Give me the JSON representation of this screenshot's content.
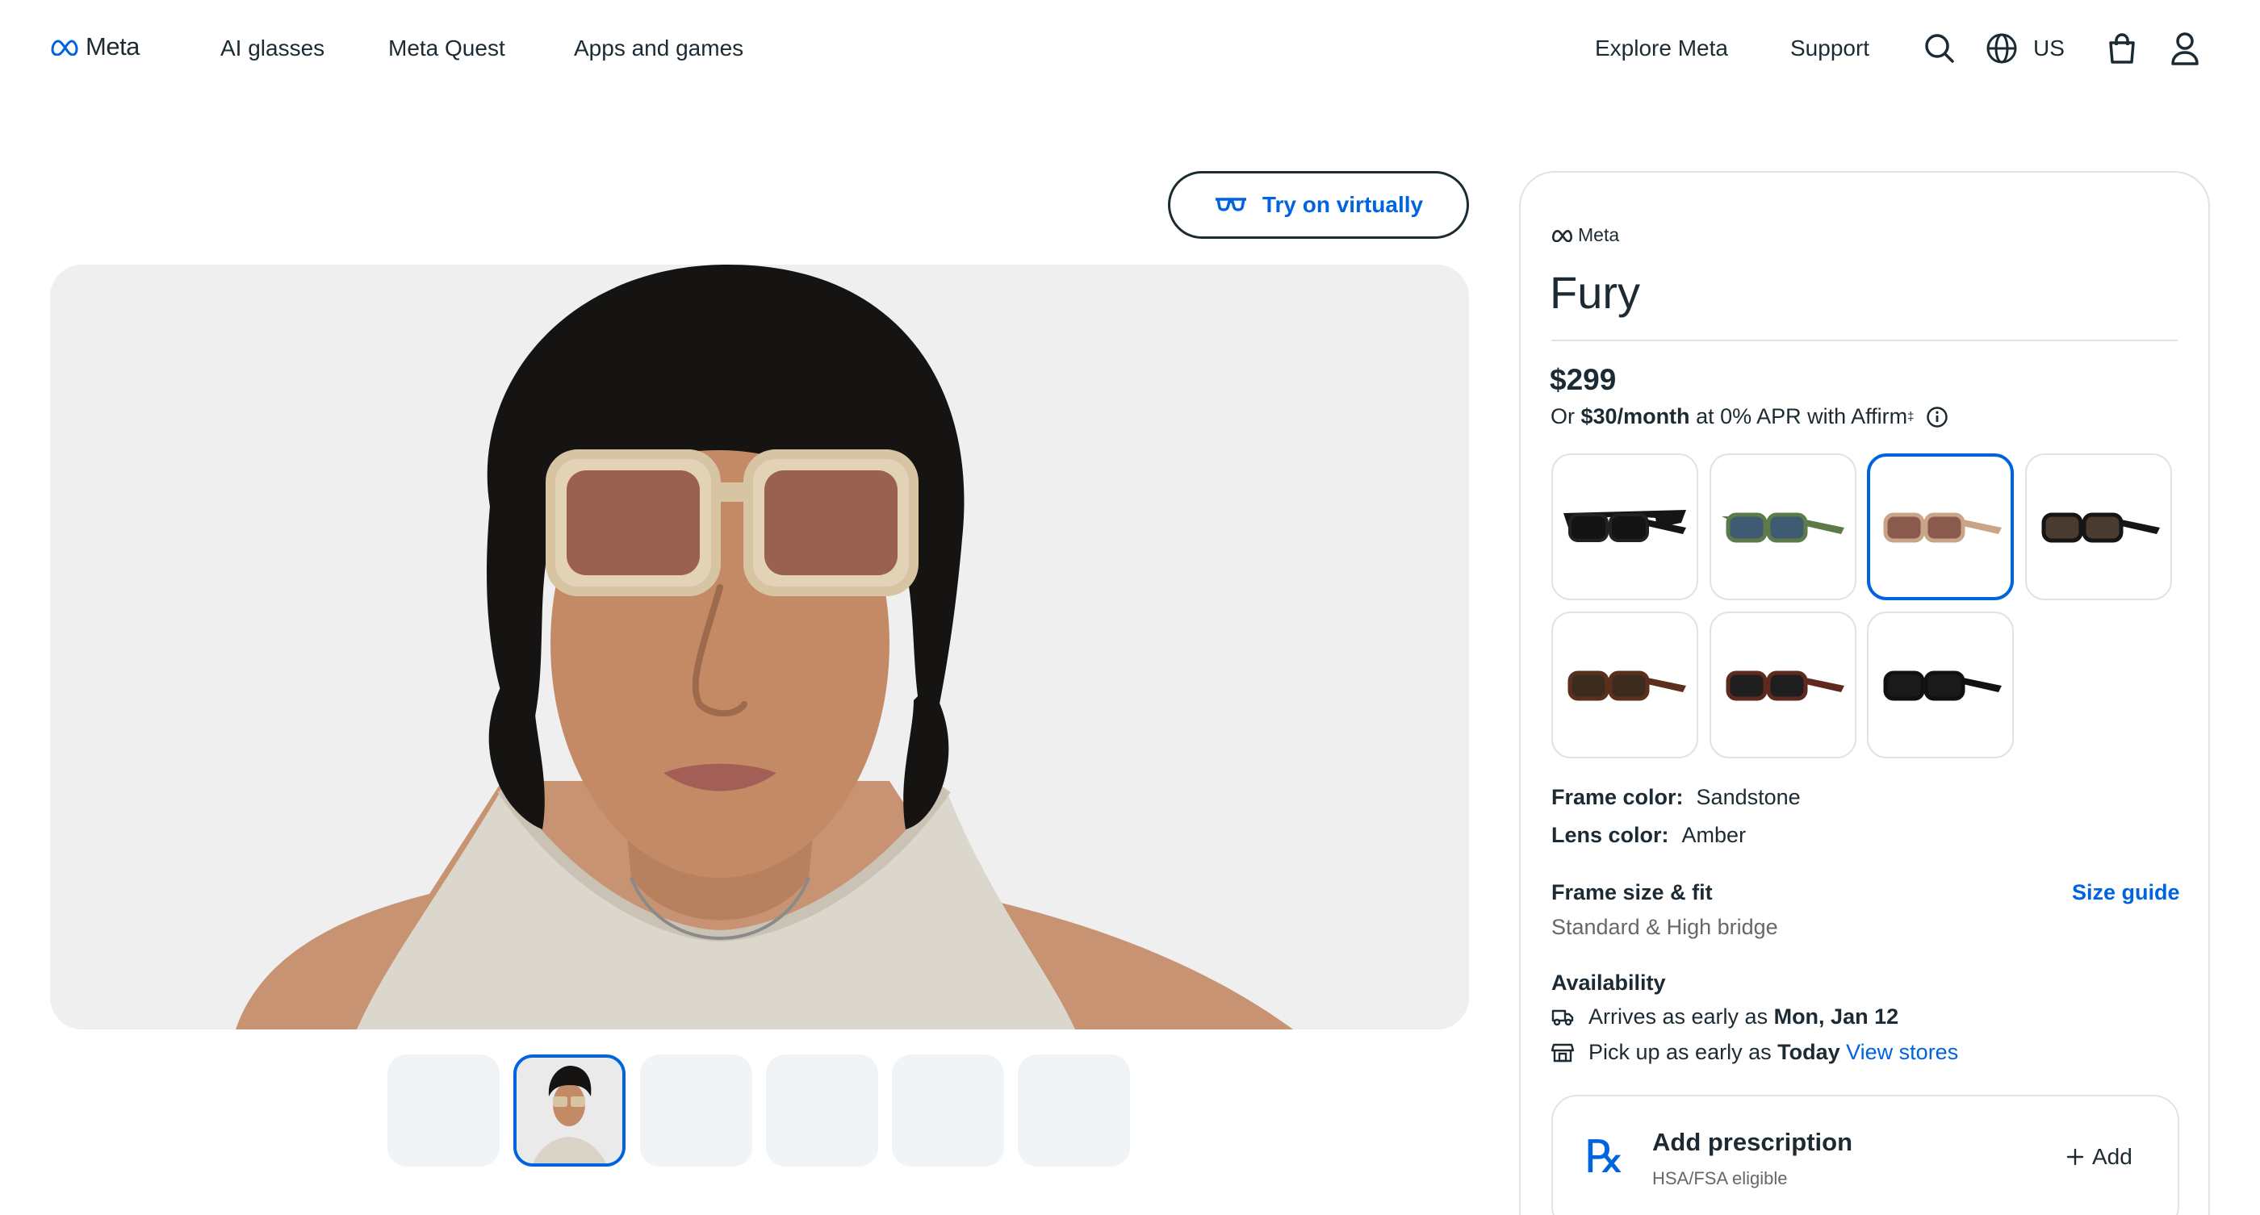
{
  "header": {
    "logo_text": "Meta",
    "nav": [
      "AI glasses",
      "Meta Quest",
      "Apps and games"
    ],
    "right_links": [
      "Explore Meta",
      "Support"
    ],
    "region": "US",
    "icons": [
      "search-icon",
      "globe-icon",
      "shopping-bag-icon",
      "account-icon"
    ]
  },
  "gallery": {
    "try_on_label": "Try on virtually",
    "selected_thumbnail": 2,
    "thumbnail_count": 6
  },
  "product": {
    "brand": "Meta",
    "title": "Fury",
    "price": "$299",
    "financing": {
      "prefix": "Or ",
      "amount": "$30/month",
      "suffix": " at 0% APR with Affirm",
      "footnote": "‡"
    },
    "swatches_selected": 3,
    "frame_color_label": "Frame color:",
    "frame_color": "Sandstone",
    "lens_color_label": "Lens color:",
    "lens_color": "Amber",
    "size_title": "Frame size & fit",
    "size_guide": "Size guide",
    "size_value": "Standard & High bridge",
    "availability_title": "Availability",
    "arrives_prefix": "Arrives as early as ",
    "arrives_date": "Mon, Jan 12",
    "pickup_prefix": "Pick up as early as ",
    "pickup_date": "Today",
    "view_stores": "View stores",
    "prescription": {
      "title": "Add prescription",
      "subtitle": "HSA/FSA eligible",
      "add_label": "Add"
    }
  },
  "colors": {
    "accent": "#0064e0",
    "text": "#1c2b33",
    "border": "#dee3e9"
  }
}
